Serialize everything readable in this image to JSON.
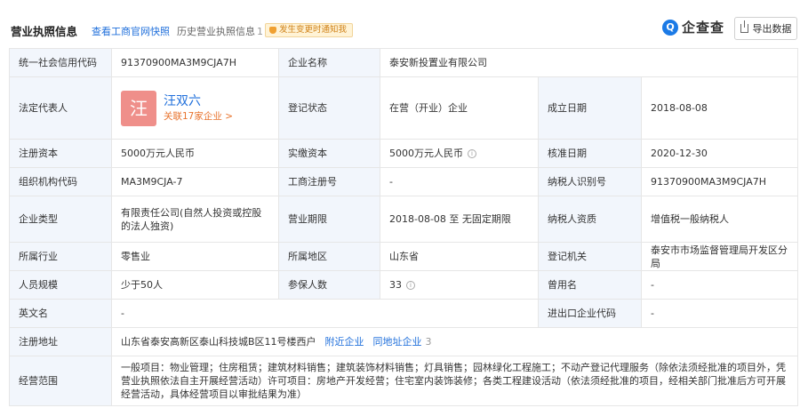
{
  "header": {
    "title": "营业执照信息",
    "link_gov": "查看工商官网快照",
    "link_history": "历史营业执照信息",
    "history_count": "1",
    "notify": "发生变更时通知我",
    "logo_mark": "Q",
    "logo_text": "企查查",
    "export": "导出数据"
  },
  "labels": {
    "credit_code": "统一社会信用代码",
    "company_name": "企业名称",
    "legal_rep": "法定代表人",
    "reg_status": "登记状态",
    "founded": "成立日期",
    "reg_capital": "注册资本",
    "paid_capital": "实缴资本",
    "approval_date": "核准日期",
    "org_code": "组织机构代码",
    "biz_reg_no": "工商注册号",
    "taxpayer_id": "纳税人识别号",
    "company_type": "企业类型",
    "biz_term": "营业期限",
    "taxpayer_qual": "纳税人资质",
    "industry": "所属行业",
    "region": "所属地区",
    "reg_authority": "登记机关",
    "staff_size": "人员规模",
    "insured": "参保人数",
    "former_name": "曾用名",
    "english_name": "英文名",
    "import_export": "进出口企业代码",
    "address": "注册地址",
    "scope": "经营范围"
  },
  "values": {
    "credit_code": "91370900MA3M9CJA7H",
    "company_name": "泰安新投置业有限公司",
    "rep_avatar": "汪",
    "rep_name": "汪双六",
    "rep_related": "关联17家企业 >",
    "reg_status": "在营（开业）企业",
    "founded": "2018-08-08",
    "reg_capital": "5000万元人民币",
    "paid_capital": "5000万元人民币",
    "approval_date": "2020-12-30",
    "org_code": "MA3M9CJA-7",
    "biz_reg_no": "-",
    "taxpayer_id": "91370900MA3M9CJA7H",
    "company_type": "有限责任公司(自然人投资或控股的法人独资)",
    "biz_term": "2018-08-08 至 无固定期限",
    "taxpayer_qual": "增值税一般纳税人",
    "industry": "零售业",
    "region": "山东省",
    "reg_authority": "泰安市市场监督管理局开发区分局",
    "staff_size": "少于50人",
    "insured": "33",
    "former_name": "-",
    "english_name": "-",
    "import_export": "-",
    "address": "山东省泰安高新区泰山科技城B区11号楼西户",
    "address_nearby": "附近企业",
    "address_same": "同地址企业",
    "address_same_count": "3",
    "scope": "一般项目：物业管理；住房租赁；建筑材料销售；建筑装饰材料销售；灯具销售；园林绿化工程施工；不动产登记代理服务（除依法须经批准的项目外，凭营业执照依法自主开展经营活动）许可项目：房地产开发经营；住宅室内装饰装修；各类工程建设活动（依法须经批准的项目，经相关部门批准后方可开展经营活动，具体经营项目以审批结果为准）"
  },
  "icons": {
    "info": "i"
  }
}
